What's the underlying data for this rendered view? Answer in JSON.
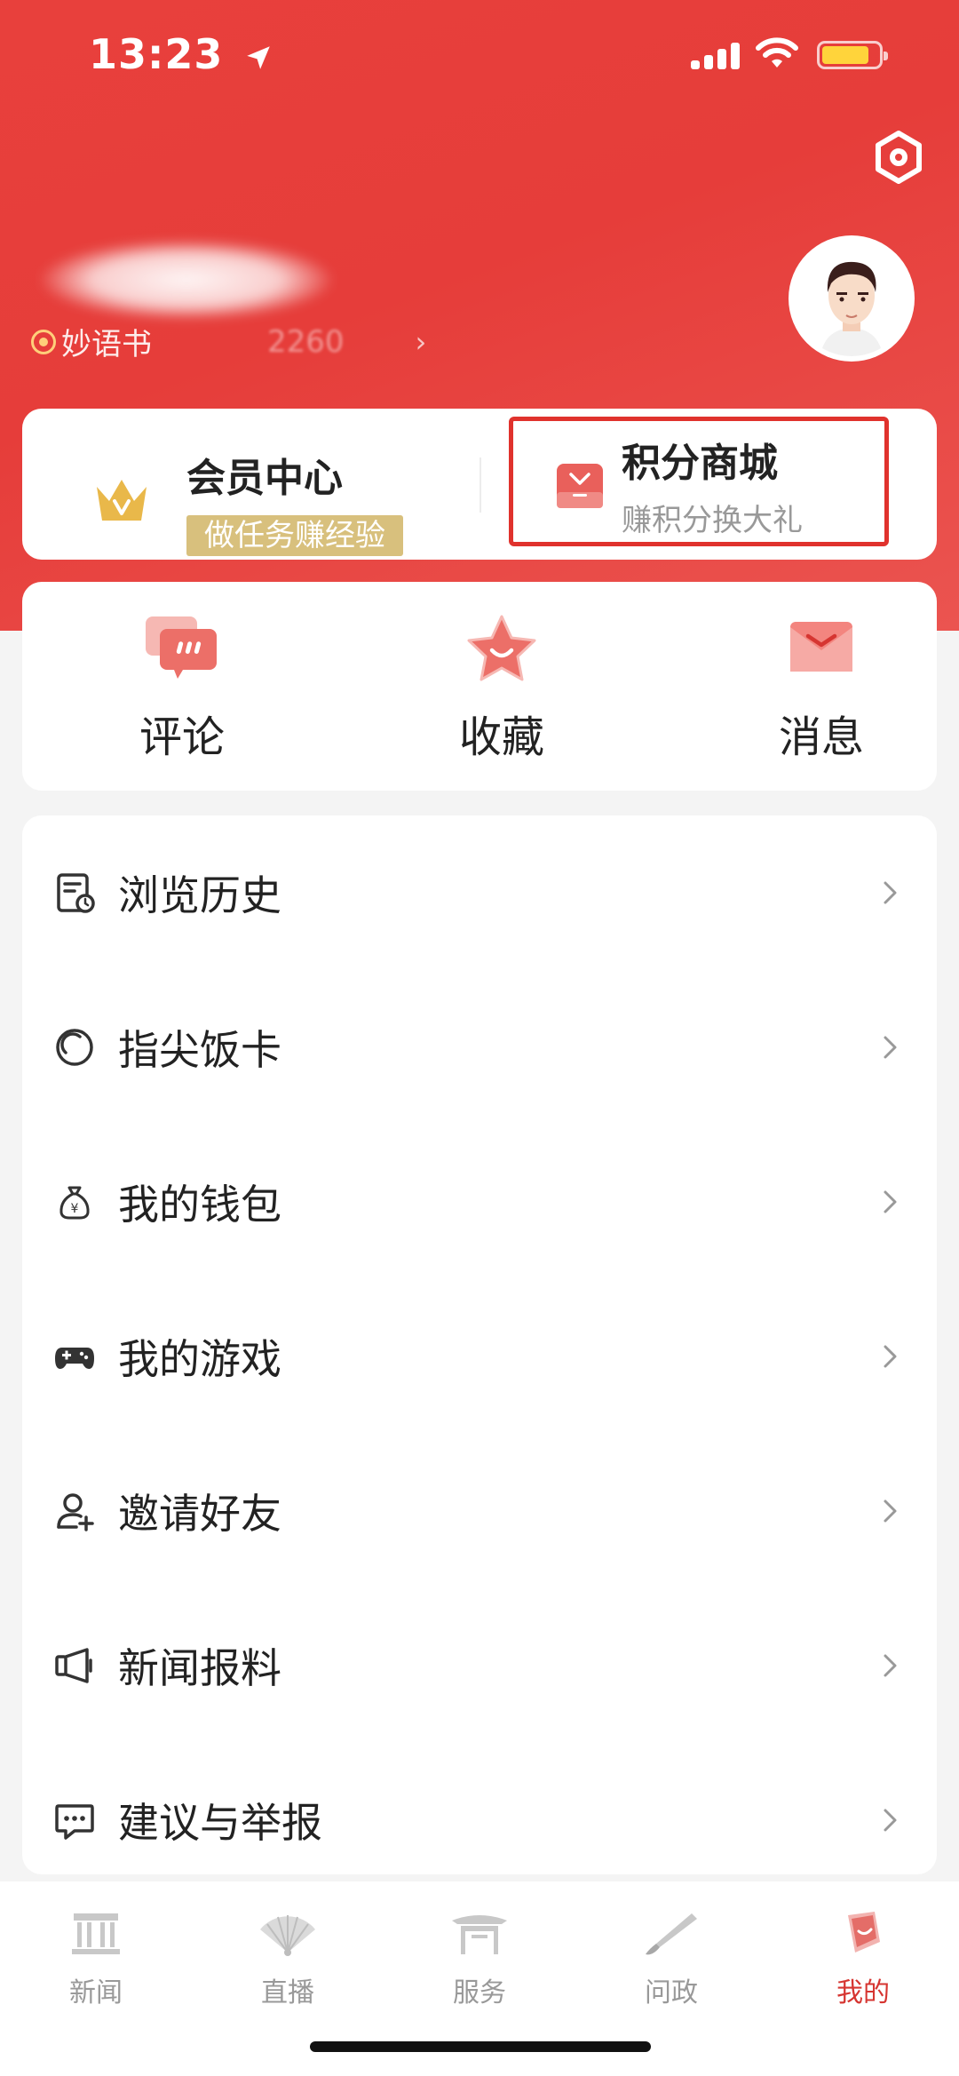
{
  "status_bar": {
    "time": "13:23"
  },
  "profile": {
    "name": "",
    "sub_prefix": "妙语书",
    "sub_masked": "2260"
  },
  "member_card": {
    "member_title": "会员中心",
    "member_sub": "做任务赚经验",
    "mall_title": "积分商城",
    "mall_sub": "赚积分换大礼"
  },
  "quick_actions": [
    {
      "label": "评论",
      "icon": "comment-icon"
    },
    {
      "label": "收藏",
      "icon": "star-icon"
    },
    {
      "label": "消息",
      "icon": "envelope-icon"
    }
  ],
  "menu": [
    {
      "label": "浏览历史",
      "icon": "history-icon"
    },
    {
      "label": "指尖饭卡",
      "icon": "meal-card-icon"
    },
    {
      "label": "我的钱包",
      "icon": "wallet-icon"
    },
    {
      "label": "我的游戏",
      "icon": "gamepad-icon"
    },
    {
      "label": "邀请好友",
      "icon": "invite-friend-icon"
    },
    {
      "label": "新闻报料",
      "icon": "megaphone-icon"
    },
    {
      "label": "建议与举报",
      "icon": "feedback-icon"
    }
  ],
  "tab_bar": [
    {
      "label": "新闻",
      "icon": "news-pavilion-icon",
      "active": false
    },
    {
      "label": "直播",
      "icon": "fan-icon",
      "active": false
    },
    {
      "label": "服务",
      "icon": "gate-icon",
      "active": false
    },
    {
      "label": "问政",
      "icon": "brush-icon",
      "active": false
    },
    {
      "label": "我的",
      "icon": "profile-icon",
      "active": true
    }
  ],
  "colors": {
    "header_red": "#e8403c",
    "highlight_border": "#e0322d",
    "member_gold": "#d8c07d",
    "active_tab": "#d63531"
  }
}
